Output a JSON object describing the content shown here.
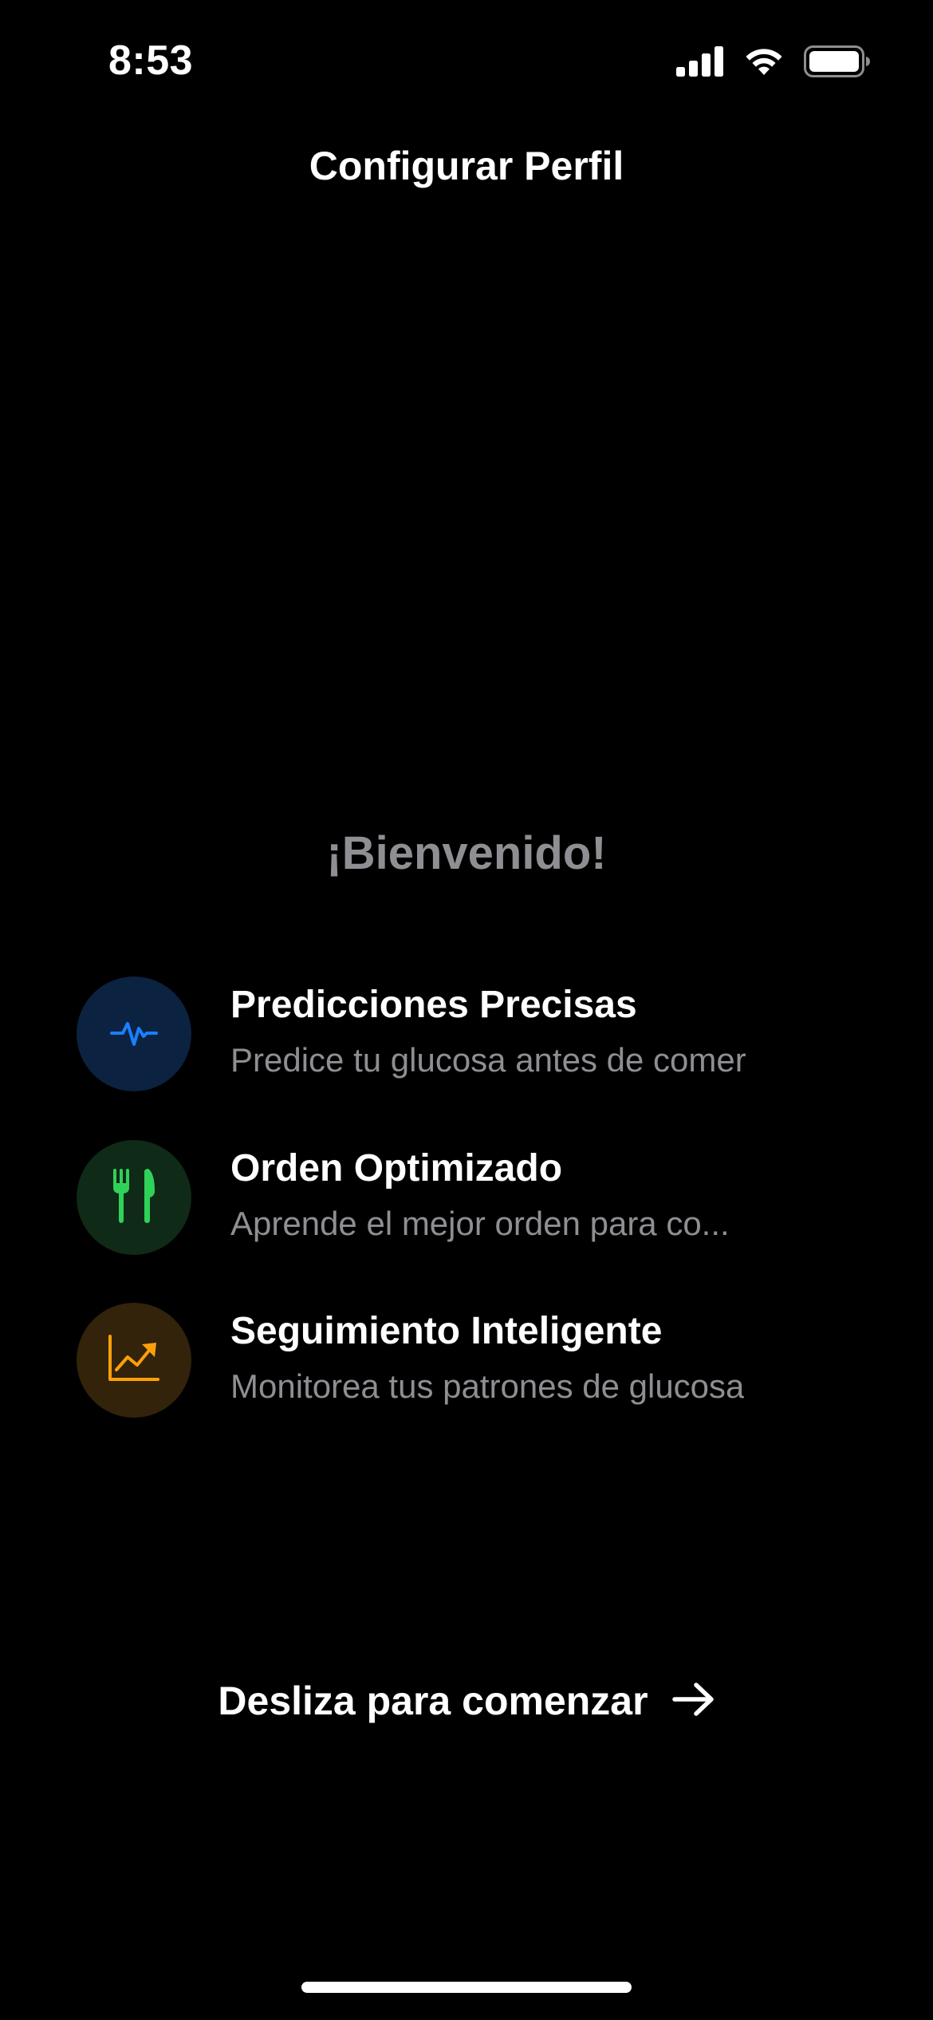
{
  "status_bar": {
    "time": "8:53",
    "icons": [
      "cellular-signal-icon",
      "wifi-icon",
      "battery-icon"
    ]
  },
  "nav": {
    "title": "Configurar Perfil"
  },
  "welcome": {
    "title": "¡Bienvenido!"
  },
  "features": [
    {
      "icon": "heartbeat-icon",
      "title": "Predicciones Precisas",
      "description": "Predice tu glucosa antes de comer",
      "accent_color": "#1a7fff",
      "bg_color": "#0b2240"
    },
    {
      "icon": "fork-knife-icon",
      "title": "Orden Optimizado",
      "description": "Aprende el mejor orden para co...",
      "accent_color": "#30d158",
      "bg_color": "#0f2a17"
    },
    {
      "icon": "trend-chart-icon",
      "title": "Seguimiento Inteligente",
      "description": "Monitorea tus patrones de glucosa",
      "accent_color": "#ff9f0a",
      "bg_color": "#33230b"
    }
  ],
  "cta": {
    "label": "Desliza para comenzar",
    "icon": "arrow-right-icon"
  },
  "colors": {
    "background": "#000000",
    "primary_text": "#ffffff",
    "secondary_text": "#8e8e93"
  }
}
